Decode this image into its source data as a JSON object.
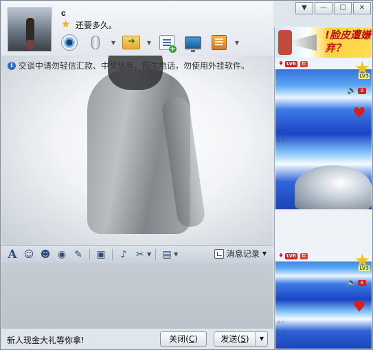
{
  "window": {
    "controls": [
      "▼",
      "—",
      "☐",
      "✕"
    ]
  },
  "contact": {
    "name": "c",
    "signature": "还要多久。"
  },
  "toolbar": {
    "buttons": [
      "video-chat",
      "voice-chat",
      "send-file",
      "whiteboard",
      "remote-assist",
      "applications"
    ]
  },
  "chat": {
    "notice": "交谈中请勿轻信汇款、中奖信息、陌生电话，勿使用外挂软件。"
  },
  "format_bar": {
    "history_label": "消息记录",
    "dropdown_glyph": "▼"
  },
  "bottom": {
    "promo": "新人现金大礼等你拿!",
    "close_label": "关闭",
    "close_key": "C",
    "send_label": "发送",
    "send_key": "S",
    "send_dropdown": "▼"
  },
  "side": {
    "ad_text": "!脸皮遭嫌弃？",
    "show1": {
      "level": "LV6",
      "year": "年",
      "star_label": "LV3",
      "vol_badge": "8"
    },
    "show2": {
      "level": "LV6",
      "year": "年",
      "star_label": "LV3",
      "vol_badge": "8"
    }
  },
  "colors": {
    "accent": "#2d4d7a",
    "promo_red": "#c30d0d",
    "badge_red": "#d81e1e"
  }
}
